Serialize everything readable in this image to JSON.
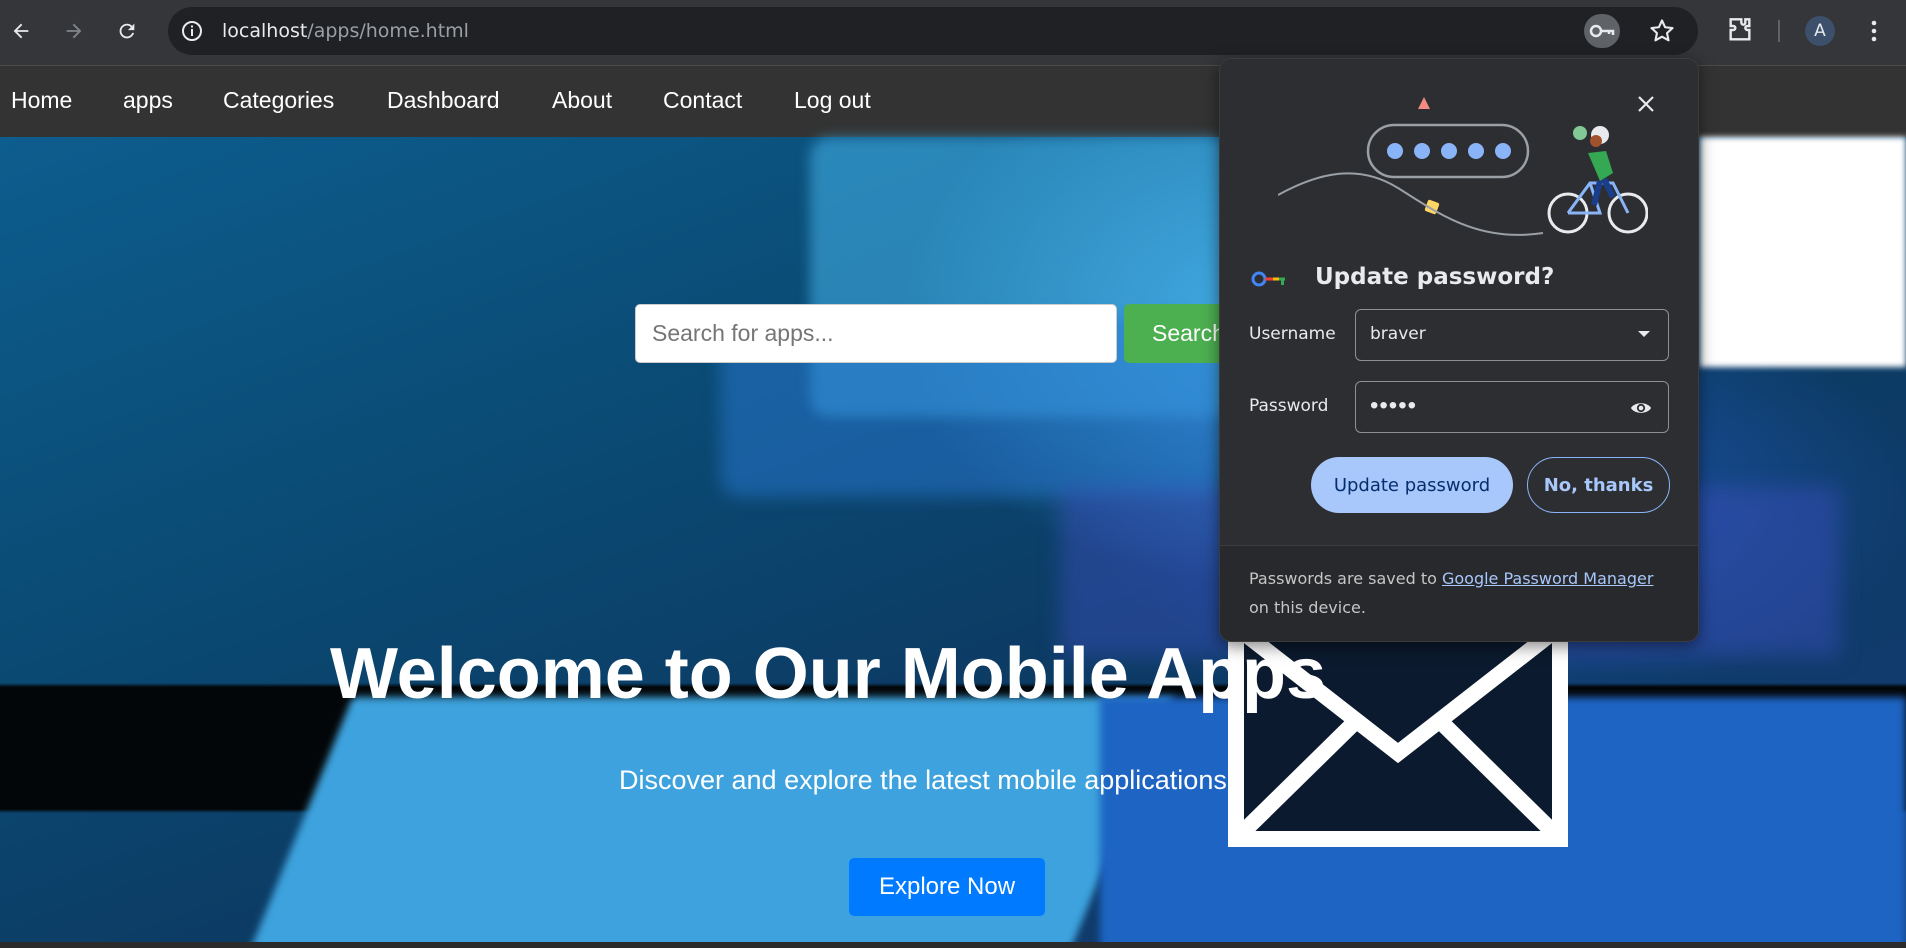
{
  "browser": {
    "url_host": "localhost",
    "url_path": "/apps/home.html",
    "avatar_letter": "A"
  },
  "site_nav": {
    "items": [
      "Home",
      "apps",
      "Categories",
      "Dashboard",
      "About",
      "Contact",
      "Log out"
    ]
  },
  "search": {
    "placeholder": "Search for apps...",
    "button_label": "Search"
  },
  "hero": {
    "title": "Welcome to Our Mobile Apps",
    "subtitle": "Discover and explore the latest mobile applications.",
    "cta_label": "Explore Now"
  },
  "password_popup": {
    "title": "Update password?",
    "username_label": "Username",
    "username_value": "braver",
    "password_label": "Password",
    "password_masked": "•••••",
    "update_button": "Update password",
    "no_thanks_button": "No, thanks",
    "footer_prefix": "Passwords are saved to",
    "footer_link": "Google Password Manager",
    "footer_suffix": "on this device."
  },
  "colors": {
    "search_button": "#4caf50",
    "cta_button": "#007bff",
    "popup_primary": "#a8c7fa"
  }
}
